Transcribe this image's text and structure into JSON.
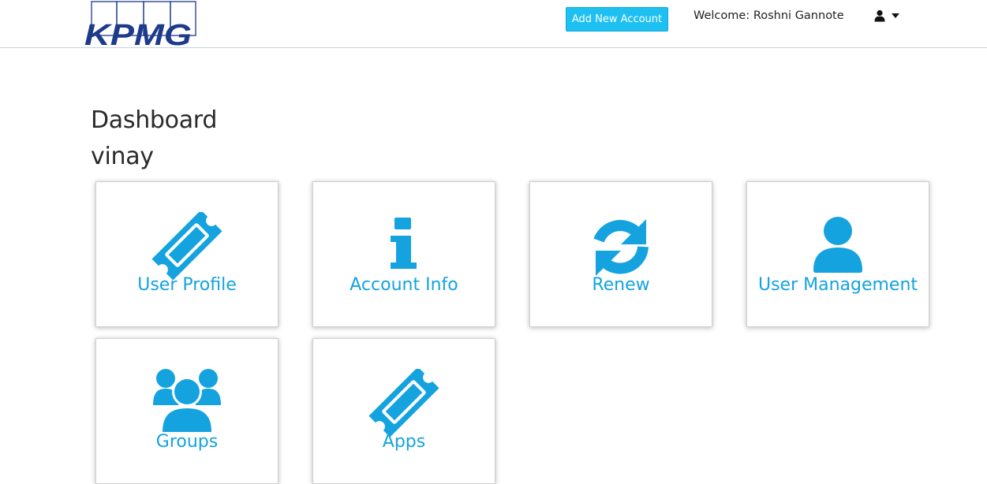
{
  "header": {
    "logo_text": "KPMG",
    "add_account_label": "Add New Account",
    "welcome_text": "Welcome: Roshni Gannote",
    "user_menu_icon": "user-icon",
    "caret_icon": "caret-down-icon"
  },
  "page": {
    "title": "Dashboard",
    "subtitle": "vinay"
  },
  "tiles": [
    {
      "label": "User Profile",
      "icon": "ticket-icon"
    },
    {
      "label": "Account Info",
      "icon": "info-icon"
    },
    {
      "label": "Renew",
      "icon": "refresh-icon"
    },
    {
      "label": "User Management",
      "icon": "user-icon"
    },
    {
      "label": "Groups",
      "icon": "group-icon"
    },
    {
      "label": "Apps",
      "icon": "ticket-icon"
    }
  ],
  "colors": {
    "accent": "#14a3df",
    "button": "#1ec0f2",
    "brand": "#1e3a8a"
  }
}
